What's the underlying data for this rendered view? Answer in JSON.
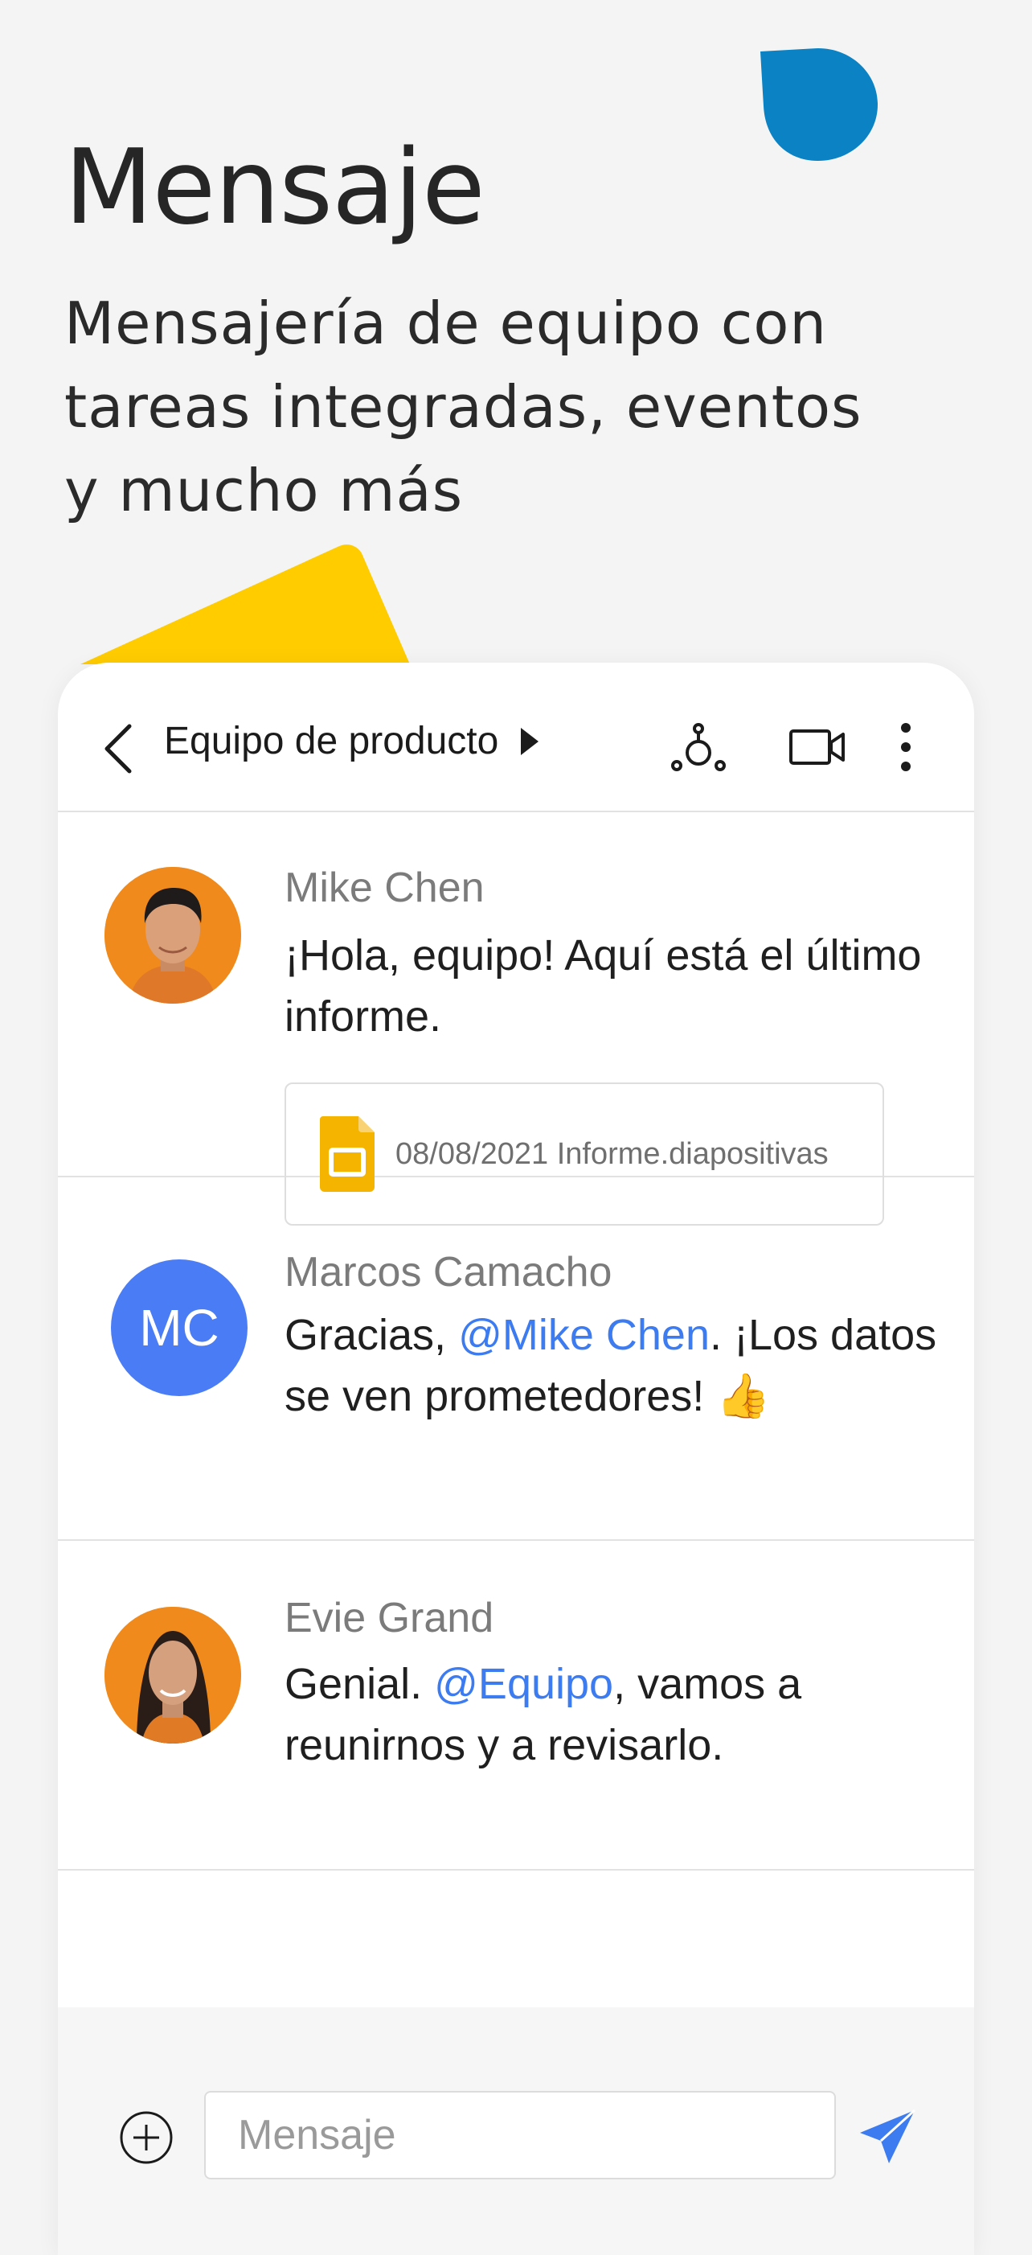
{
  "hero": {
    "title": "Mensaje",
    "subtitle_lines": [
      "Mensajería de equipo con",
      "tareas integradas, eventos",
      "y mucho más"
    ]
  },
  "colors": {
    "accent_blue": "#0a82c4",
    "accent_yellow": "#ffcc00",
    "mention": "#3c7bf0",
    "avatar_mc": "#4a7cf5"
  },
  "chat": {
    "title": "Equipo de producto",
    "icons": {
      "back": "chevron-left-icon",
      "expand": "caret-right-icon",
      "people": "people-icon",
      "video": "video-camera-icon",
      "more": "more-vertical-icon"
    },
    "messages": [
      {
        "sender": "Mike Chen",
        "text": "¡Hola, equipo! Aquí está el último informe.",
        "attachment": {
          "label": "08/08/2021 Informe.diapositivas",
          "icon": "slides-file-icon"
        }
      },
      {
        "sender": "Marcos Camacho",
        "initials": "MC",
        "text_before": "Gracias, ",
        "mention": "@Mike Chen",
        "text_after": ". ¡Los datos se ven prometedores! 👍"
      },
      {
        "sender": "Evie Grand",
        "text_before": "Genial. ",
        "mention": "@Equipo",
        "text_after": ", vamos a reunirnos y a revisarlo."
      }
    ],
    "composer": {
      "placeholder": "Mensaje",
      "add_icon": "plus-circle-icon",
      "send_icon": "send-icon"
    }
  }
}
